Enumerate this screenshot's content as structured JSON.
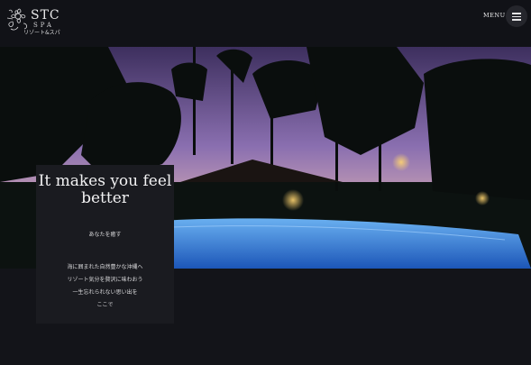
{
  "logo": {
    "brand": "STC",
    "sub_brand": "SPA",
    "tagline": "リゾート&スパ"
  },
  "header": {
    "menu_label": "MENU"
  },
  "hero": {
    "title": "It makes you feel better",
    "subtitle": "あなたを癒す",
    "description_lines": [
      "海に囲まれた自然豊かな沖縄へ",
      "リゾート気分を贅沢に味わおう",
      "一生忘れられない思い出を",
      "ここで"
    ]
  },
  "colors": {
    "background": "#131419",
    "header": "#111217",
    "card": "#1a1b20",
    "pool": "#3b7fd8",
    "sky": "#8a6fb0"
  },
  "icons": [
    "flower-logo-icon",
    "hamburger-menu-icon"
  ]
}
